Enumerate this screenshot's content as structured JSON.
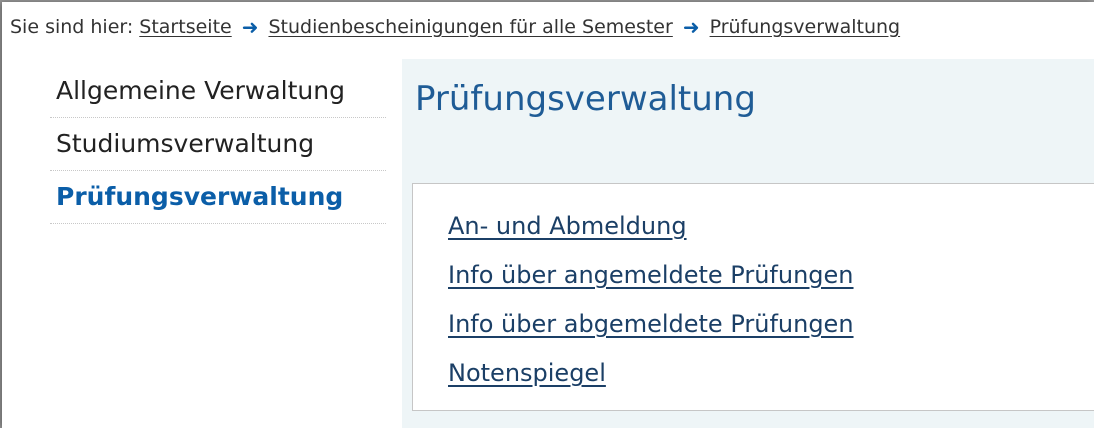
{
  "breadcrumb": {
    "prefix": "Sie sind hier:",
    "items": [
      {
        "label": "Startseite"
      },
      {
        "label": "Studienbescheinigungen für alle Semester"
      },
      {
        "label": "Prüfungsverwaltung"
      }
    ],
    "separator_icon": "arrow-right-icon"
  },
  "sidebar": {
    "items": [
      {
        "label": "Allgemeine Verwaltung",
        "active": false
      },
      {
        "label": "Studiumsverwaltung",
        "active": false
      },
      {
        "label": "Prüfungsverwaltung",
        "active": true
      }
    ]
  },
  "main": {
    "title": "Prüfungsverwaltung",
    "links": [
      {
        "label": "An- und Abmeldung"
      },
      {
        "label": "Info über angemeldete Prüfungen"
      },
      {
        "label": "Info über abgemeldete Prüfungen"
      },
      {
        "label": "Notenspiegel"
      }
    ]
  },
  "colors": {
    "accent": "#0b5ea8",
    "title": "#1f5c96",
    "content_bg": "#eef5f7"
  }
}
